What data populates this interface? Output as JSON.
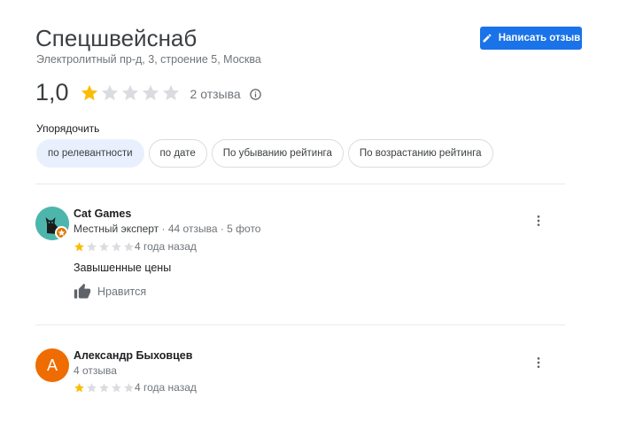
{
  "place": {
    "title": "Спецшвейснаб",
    "address": "Электролитный пр-д, 3, строение 5, Москва"
  },
  "write_review": {
    "label": "Написать отзыв"
  },
  "rating": {
    "value": "1,0",
    "stars_filled": 1,
    "stars_total": 5,
    "count_label": "2 отзыва"
  },
  "sort": {
    "label": "Упорядочить",
    "options": [
      "по релевантности",
      "по дате",
      "По убыванию рейтинга",
      "По возрастанию рейтинга"
    ],
    "selected": "по релевантности"
  },
  "reviews": [
    {
      "name": "Cat Games",
      "badge": "Местный эксперт",
      "stats": "· 44 отзыва · 5 фото",
      "stars_filled": 1,
      "time": "4 года назад",
      "text": "Завышенные цены",
      "like_label": "Нравится",
      "avatar": "cat-avatar"
    },
    {
      "name": "Александр Быховцев",
      "stats": "4 отзыва",
      "stars_filled": 1,
      "time": "4 года назад",
      "avatar_letter": "А"
    }
  ],
  "colors": {
    "accent": "#1a73e8",
    "star": "#fbbc04",
    "star_empty": "#dadce0",
    "chip_active_bg": "#e8f0fe",
    "avatar_orange": "#ef6c00",
    "avatar_teal": "#4db6ac"
  },
  "icons": {
    "write": "pencil-icon",
    "info": "info-icon",
    "like": "thumb-up-icon",
    "more": "more-vert-icon",
    "badge": "local-guide-star-icon"
  }
}
